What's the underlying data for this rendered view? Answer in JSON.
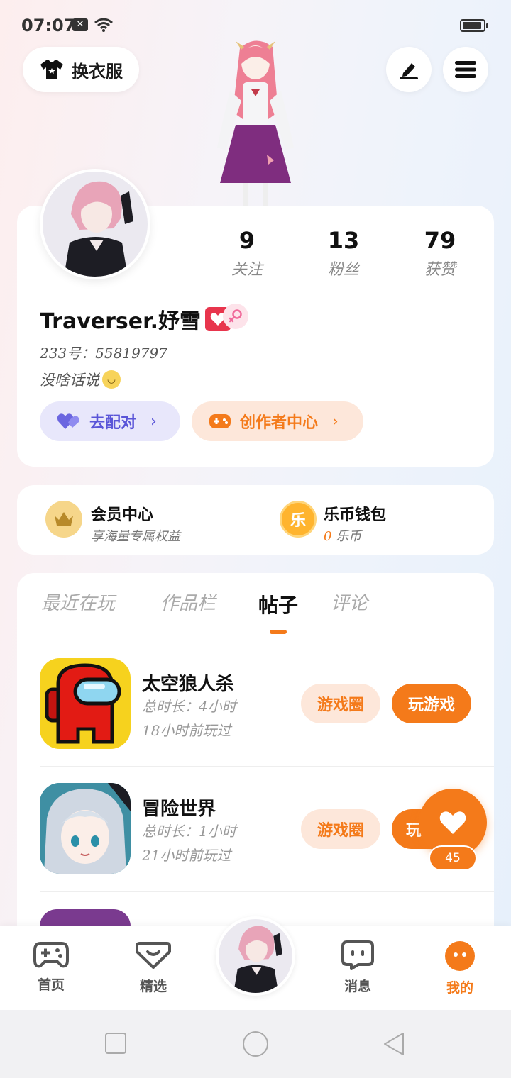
{
  "status_bar": {
    "time": "07:07"
  },
  "header": {
    "outfit_label": "换衣服"
  },
  "profile": {
    "username": "Traverser.妤雪",
    "id_line": "233号：55819797",
    "bio": "没啥话说",
    "stats": [
      {
        "value": "9",
        "label": "关注"
      },
      {
        "value": "13",
        "label": "粉丝"
      },
      {
        "value": "79",
        "label": "获赞"
      }
    ],
    "match_label": "去配对",
    "creator_label": "创作者中心"
  },
  "member": {
    "vip_title": "会员中心",
    "vip_sub": "享海量专属权益",
    "wallet_title": "乐币钱包",
    "wallet_icon_char": "乐",
    "wallet_amount": "0",
    "wallet_unit": "乐币"
  },
  "tabs": [
    {
      "label": "最近在玩",
      "active": false
    },
    {
      "label": "作品栏",
      "active": false
    },
    {
      "label": "帖子",
      "active": true
    },
    {
      "label": "评论",
      "active": false
    }
  ],
  "games": [
    {
      "title": "太空狼人杀",
      "duration": "总时长：4小时",
      "last_played": "18小时前玩过",
      "circle_label": "游戏圈",
      "play_label": "玩游戏"
    },
    {
      "title": "冒险世界",
      "duration": "总时长：1小时",
      "last_played": "21小时前玩过",
      "circle_label": "游戏圈",
      "play_label": "玩"
    },
    {
      "title": ""
    }
  ],
  "fab": {
    "count": "45"
  },
  "bottom_nav": [
    {
      "label": "首页",
      "icon": "gamepad-icon",
      "active": false
    },
    {
      "label": "精选",
      "icon": "heart-chat-icon",
      "active": false
    },
    {
      "label": "消息",
      "icon": "message-icon",
      "active": false
    },
    {
      "label": "我的",
      "icon": "profile-face-icon",
      "active": true
    }
  ],
  "colors": {
    "accent": "#f47a1a",
    "match": "#5a55d8"
  }
}
